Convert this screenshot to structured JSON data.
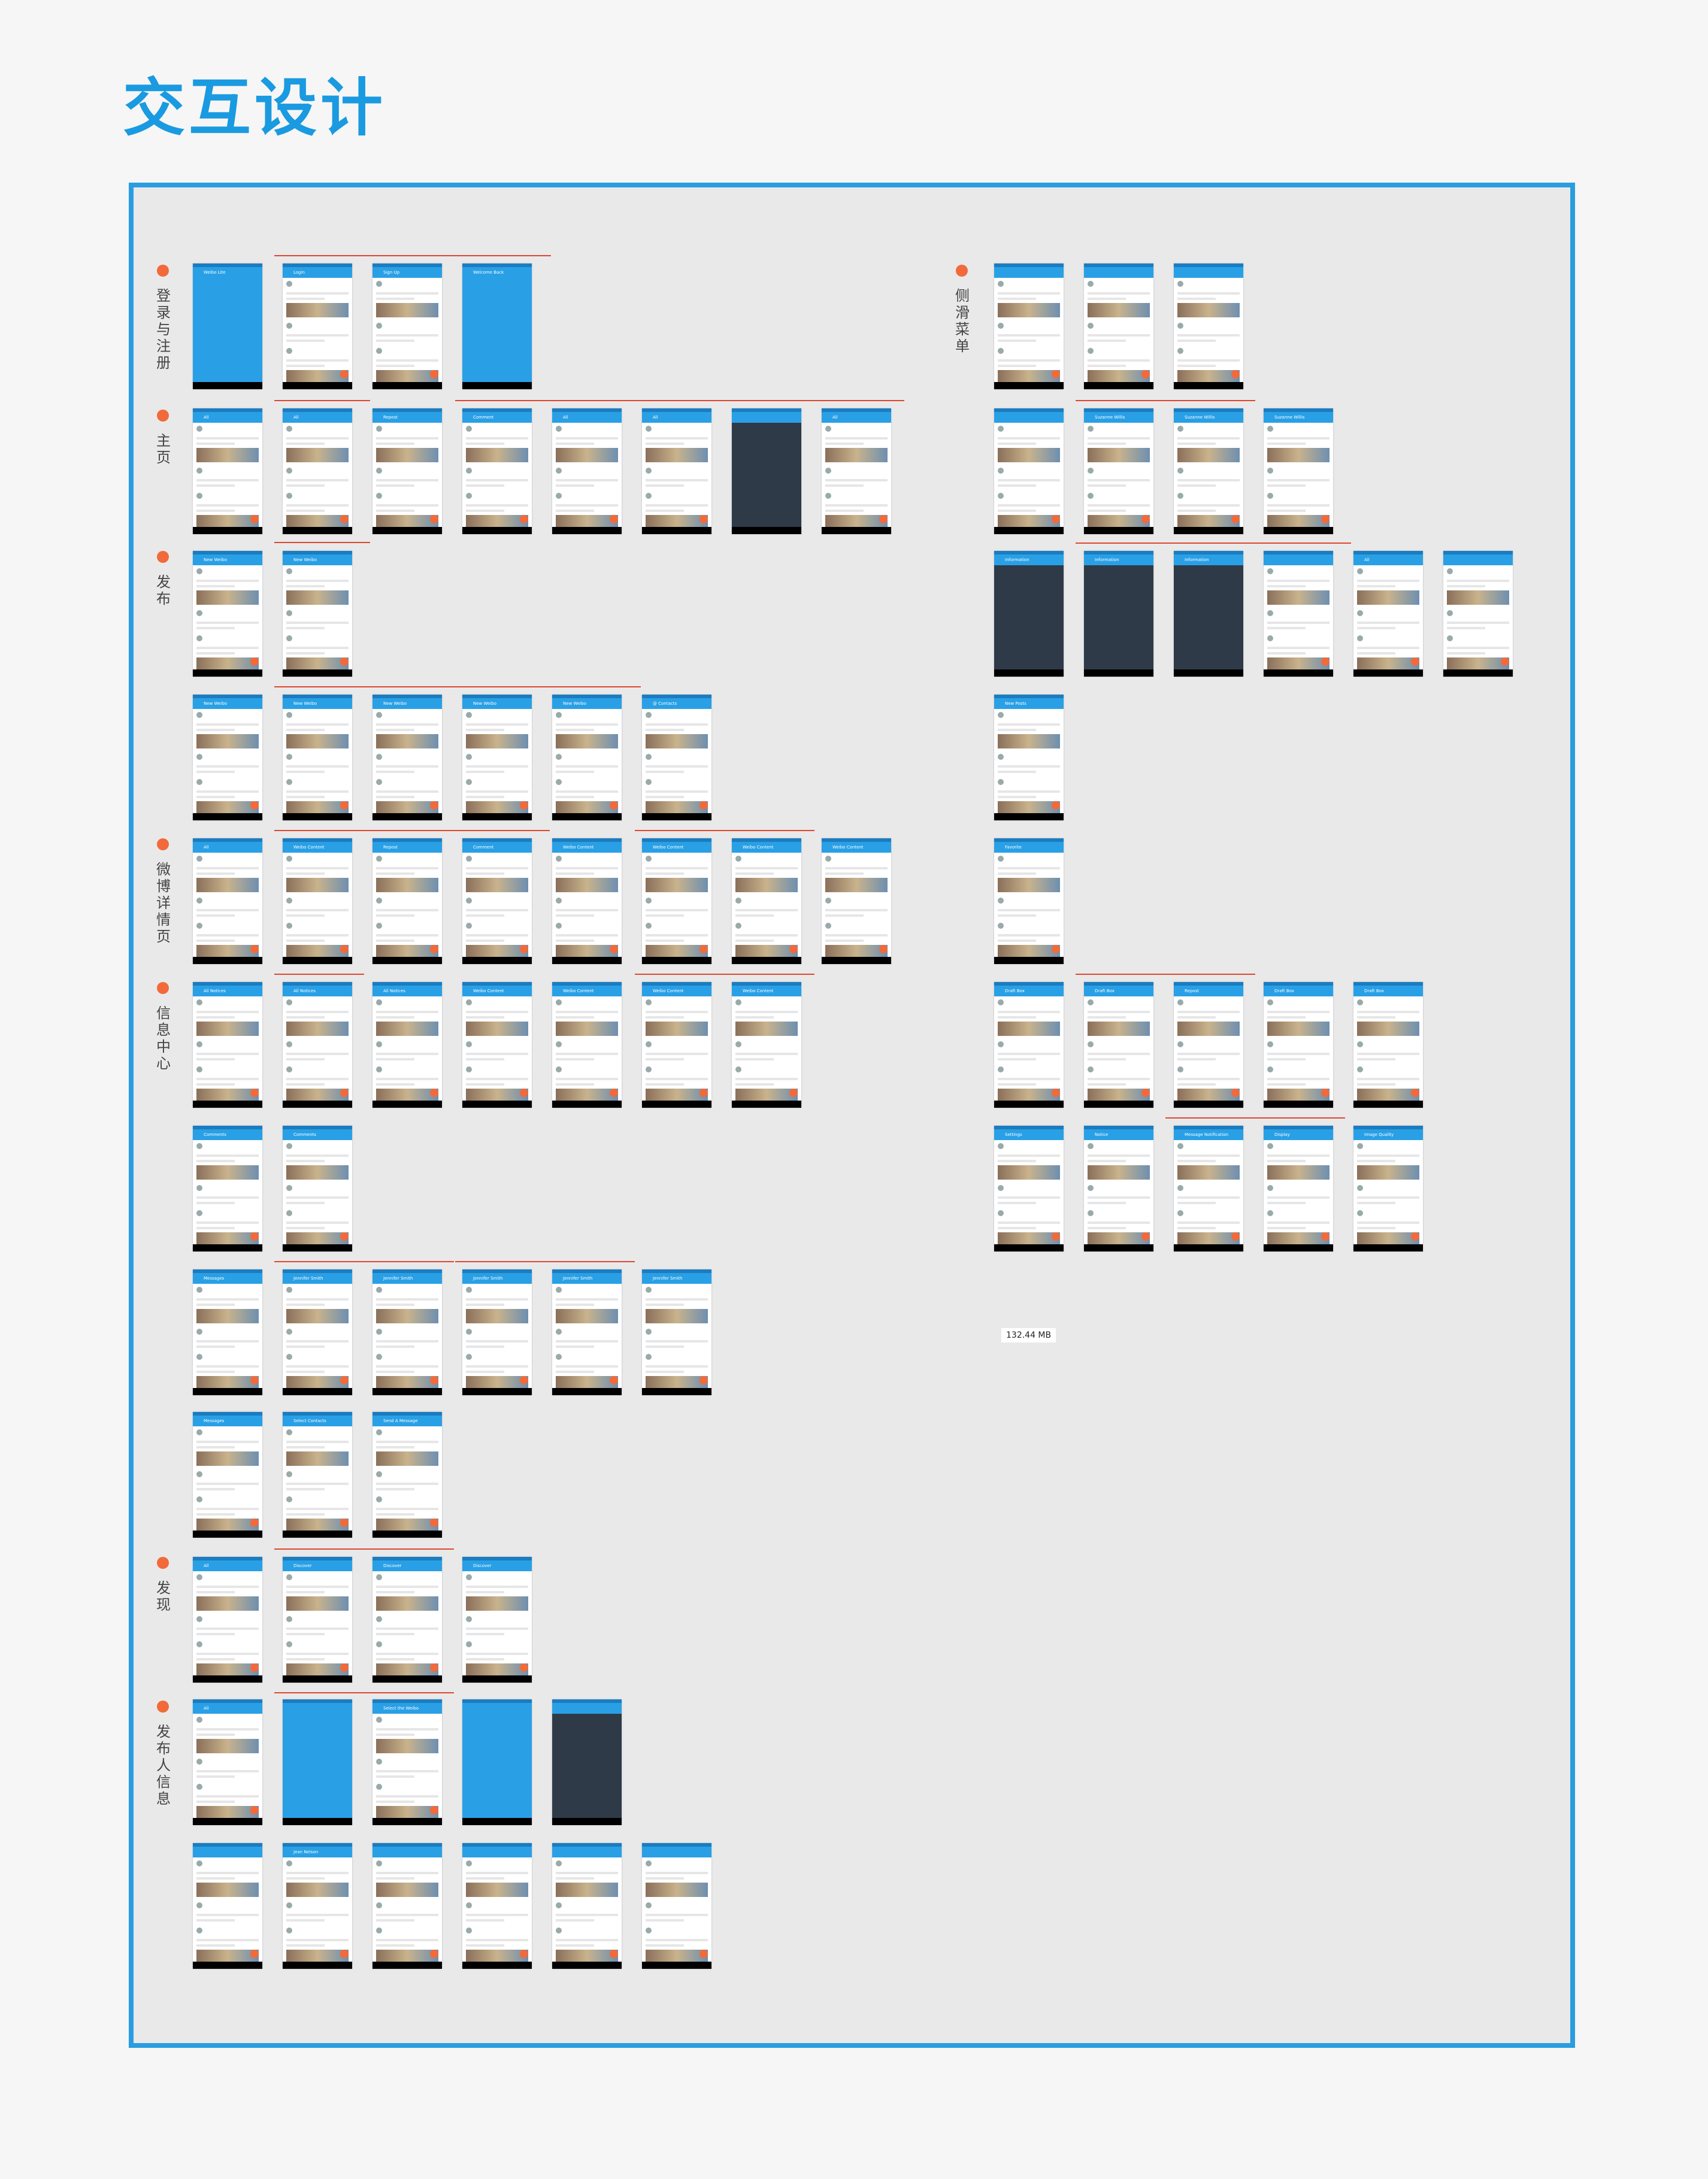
{
  "page": {
    "title": "交互设计"
  },
  "sections_left": [
    {
      "label": "登录与注册"
    },
    {
      "label": "主页"
    },
    {
      "label": "发布"
    },
    {
      "label": "微博详情页"
    },
    {
      "label": "信息中心"
    },
    {
      "label": "发现"
    },
    {
      "label": "发布人信息"
    }
  ],
  "sections_right": [
    {
      "label": "侧滑菜单"
    }
  ],
  "screens": {
    "login_row": [
      "Weibo Lite",
      "Login",
      "Sign Up",
      "Welcome Back"
    ],
    "home_row": [
      "All",
      "All",
      "Repost",
      "Comment",
      "All",
      "All",
      "",
      "All"
    ],
    "publish_row1": [
      "New Weibo",
      "New Weibo"
    ],
    "publish_row2": [
      "New Weibo",
      "New Weibo",
      "New Weibo",
      "New Weibo",
      "New Weibo",
      "@ Contacts"
    ],
    "detail_row": [
      "All",
      "Weibo Content",
      "Repost",
      "Comment",
      "Weibo Content",
      "Weibo Content",
      "Weibo Content",
      "Weibo Content"
    ],
    "msg_row1": [
      "All Notices",
      "All Notices",
      "All Notices",
      "Weibo Content",
      "Weibo Content",
      "Weibo Content",
      "Weibo Content"
    ],
    "msg_row2": [
      "Comments",
      "Comments"
    ],
    "msg_row3": [
      "Messages",
      "Jennifer Smith",
      "Jennifer Smith",
      "Jennifer Smith",
      "Jennifer Smith",
      "Jennifer Smith"
    ],
    "msg_row4": [
      "Messages",
      "Select Contacts",
      "Send A Message"
    ],
    "discover_row": [
      "All",
      "Discover",
      "Discover",
      "Discover"
    ],
    "profile_row1": [
      "All",
      "",
      "Select the Weibo",
      "",
      ""
    ],
    "profile_row2": [
      "",
      "Jean Nelson",
      "",
      "",
      "",
      ""
    ],
    "menu_row1": [
      "",
      "",
      ""
    ],
    "menu_row2": [
      "",
      "Suzanne Willis",
      "Suzanne Willis",
      "Suzanne Willis"
    ],
    "menu_row3": [
      "Information",
      "Information",
      "Information",
      "",
      "All",
      ""
    ],
    "menu_col": [
      "New Posts",
      "Favorite"
    ],
    "menu_row4": [
      "Draft Box",
      "Draft Box",
      "Repost",
      "Draft Box",
      "Draft Box"
    ],
    "menu_row5": [
      "Settings",
      "Notice",
      "Message Notification",
      "Display",
      "Image Quality"
    ],
    "menu_storage": {
      "size": "132.44 MB"
    }
  },
  "colors": {
    "accent": "#29a0e6",
    "frame": "#2a9de0",
    "marker": "#f26a3a",
    "connector": "#e0462e"
  }
}
